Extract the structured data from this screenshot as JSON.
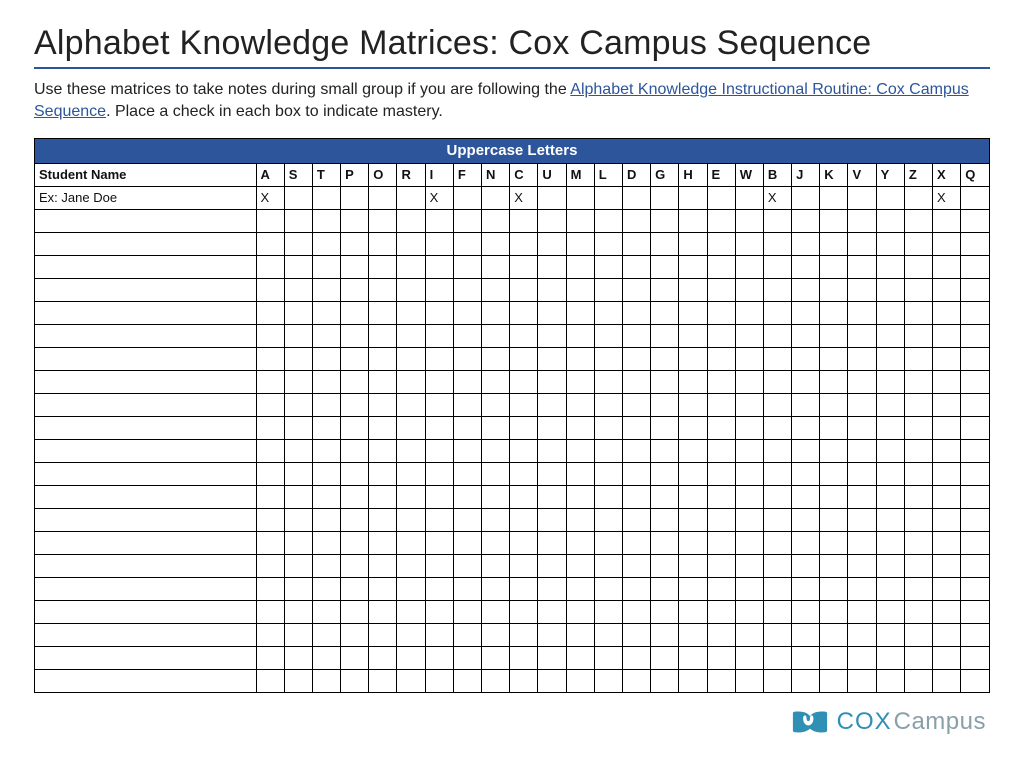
{
  "title": "Alphabet Knowledge Matrices: Cox Campus Sequence",
  "intro": {
    "pre": "Use these matrices to take notes during small group if you are following the ",
    "link": "Alphabet Knowledge Instructional Routine: Cox Campus Sequence",
    "post": ". Place a check in each box to indicate mastery."
  },
  "table": {
    "banner": "Uppercase Letters",
    "name_header": "Student Name",
    "letters": [
      "A",
      "S",
      "T",
      "P",
      "O",
      "R",
      "I",
      "F",
      "N",
      "C",
      "U",
      "M",
      "L",
      "D",
      "G",
      "H",
      "E",
      "W",
      "B",
      "J",
      "K",
      "V",
      "Y",
      "Z",
      "X",
      "Q"
    ],
    "rows": [
      {
        "name": "Ex: Jane Doe",
        "marks": [
          "X",
          "",
          "",
          "",
          "",
          "",
          "X",
          "",
          "",
          "X",
          "",
          "",
          "",
          "",
          "",
          "",
          "",
          "",
          "X",
          "",
          "",
          "",
          "",
          "",
          "X",
          ""
        ]
      },
      {
        "name": "",
        "marks": [
          "",
          "",
          "",
          "",
          "",
          "",
          "",
          "",
          "",
          "",
          "",
          "",
          "",
          "",
          "",
          "",
          "",
          "",
          "",
          "",
          "",
          "",
          "",
          "",
          "",
          ""
        ]
      },
      {
        "name": "",
        "marks": [
          "",
          "",
          "",
          "",
          "",
          "",
          "",
          "",
          "",
          "",
          "",
          "",
          "",
          "",
          "",
          "",
          "",
          "",
          "",
          "",
          "",
          "",
          "",
          "",
          "",
          ""
        ]
      },
      {
        "name": "",
        "marks": [
          "",
          "",
          "",
          "",
          "",
          "",
          "",
          "",
          "",
          "",
          "",
          "",
          "",
          "",
          "",
          "",
          "",
          "",
          "",
          "",
          "",
          "",
          "",
          "",
          "",
          ""
        ]
      },
      {
        "name": "",
        "marks": [
          "",
          "",
          "",
          "",
          "",
          "",
          "",
          "",
          "",
          "",
          "",
          "",
          "",
          "",
          "",
          "",
          "",
          "",
          "",
          "",
          "",
          "",
          "",
          "",
          "",
          ""
        ]
      },
      {
        "name": "",
        "marks": [
          "",
          "",
          "",
          "",
          "",
          "",
          "",
          "",
          "",
          "",
          "",
          "",
          "",
          "",
          "",
          "",
          "",
          "",
          "",
          "",
          "",
          "",
          "",
          "",
          "",
          ""
        ]
      },
      {
        "name": "",
        "marks": [
          "",
          "",
          "",
          "",
          "",
          "",
          "",
          "",
          "",
          "",
          "",
          "",
          "",
          "",
          "",
          "",
          "",
          "",
          "",
          "",
          "",
          "",
          "",
          "",
          "",
          ""
        ]
      },
      {
        "name": "",
        "marks": [
          "",
          "",
          "",
          "",
          "",
          "",
          "",
          "",
          "",
          "",
          "",
          "",
          "",
          "",
          "",
          "",
          "",
          "",
          "",
          "",
          "",
          "",
          "",
          "",
          "",
          ""
        ]
      },
      {
        "name": "",
        "marks": [
          "",
          "",
          "",
          "",
          "",
          "",
          "",
          "",
          "",
          "",
          "",
          "",
          "",
          "",
          "",
          "",
          "",
          "",
          "",
          "",
          "",
          "",
          "",
          "",
          "",
          ""
        ]
      },
      {
        "name": "",
        "marks": [
          "",
          "",
          "",
          "",
          "",
          "",
          "",
          "",
          "",
          "",
          "",
          "",
          "",
          "",
          "",
          "",
          "",
          "",
          "",
          "",
          "",
          "",
          "",
          "",
          "",
          ""
        ]
      },
      {
        "name": "",
        "marks": [
          "",
          "",
          "",
          "",
          "",
          "",
          "",
          "",
          "",
          "",
          "",
          "",
          "",
          "",
          "",
          "",
          "",
          "",
          "",
          "",
          "",
          "",
          "",
          "",
          "",
          ""
        ]
      },
      {
        "name": "",
        "marks": [
          "",
          "",
          "",
          "",
          "",
          "",
          "",
          "",
          "",
          "",
          "",
          "",
          "",
          "",
          "",
          "",
          "",
          "",
          "",
          "",
          "",
          "",
          "",
          "",
          "",
          ""
        ]
      },
      {
        "name": "",
        "marks": [
          "",
          "",
          "",
          "",
          "",
          "",
          "",
          "",
          "",
          "",
          "",
          "",
          "",
          "",
          "",
          "",
          "",
          "",
          "",
          "",
          "",
          "",
          "",
          "",
          "",
          ""
        ]
      },
      {
        "name": "",
        "marks": [
          "",
          "",
          "",
          "",
          "",
          "",
          "",
          "",
          "",
          "",
          "",
          "",
          "",
          "",
          "",
          "",
          "",
          "",
          "",
          "",
          "",
          "",
          "",
          "",
          "",
          ""
        ]
      },
      {
        "name": "",
        "marks": [
          "",
          "",
          "",
          "",
          "",
          "",
          "",
          "",
          "",
          "",
          "",
          "",
          "",
          "",
          "",
          "",
          "",
          "",
          "",
          "",
          "",
          "",
          "",
          "",
          "",
          ""
        ]
      },
      {
        "name": "",
        "marks": [
          "",
          "",
          "",
          "",
          "",
          "",
          "",
          "",
          "",
          "",
          "",
          "",
          "",
          "",
          "",
          "",
          "",
          "",
          "",
          "",
          "",
          "",
          "",
          "",
          "",
          ""
        ]
      },
      {
        "name": "",
        "marks": [
          "",
          "",
          "",
          "",
          "",
          "",
          "",
          "",
          "",
          "",
          "",
          "",
          "",
          "",
          "",
          "",
          "",
          "",
          "",
          "",
          "",
          "",
          "",
          "",
          "",
          ""
        ]
      },
      {
        "name": "",
        "marks": [
          "",
          "",
          "",
          "",
          "",
          "",
          "",
          "",
          "",
          "",
          "",
          "",
          "",
          "",
          "",
          "",
          "",
          "",
          "",
          "",
          "",
          "",
          "",
          "",
          "",
          ""
        ]
      },
      {
        "name": "",
        "marks": [
          "",
          "",
          "",
          "",
          "",
          "",
          "",
          "",
          "",
          "",
          "",
          "",
          "",
          "",
          "",
          "",
          "",
          "",
          "",
          "",
          "",
          "",
          "",
          "",
          "",
          ""
        ]
      },
      {
        "name": "",
        "marks": [
          "",
          "",
          "",
          "",
          "",
          "",
          "",
          "",
          "",
          "",
          "",
          "",
          "",
          "",
          "",
          "",
          "",
          "",
          "",
          "",
          "",
          "",
          "",
          "",
          "",
          ""
        ]
      },
      {
        "name": "",
        "marks": [
          "",
          "",
          "",
          "",
          "",
          "",
          "",
          "",
          "",
          "",
          "",
          "",
          "",
          "",
          "",
          "",
          "",
          "",
          "",
          "",
          "",
          "",
          "",
          "",
          "",
          ""
        ]
      },
      {
        "name": "",
        "marks": [
          "",
          "",
          "",
          "",
          "",
          "",
          "",
          "",
          "",
          "",
          "",
          "",
          "",
          "",
          "",
          "",
          "",
          "",
          "",
          "",
          "",
          "",
          "",
          "",
          "",
          ""
        ]
      }
    ]
  },
  "footer": {
    "brand_cox": "COX",
    "brand_campus": "Campus"
  }
}
